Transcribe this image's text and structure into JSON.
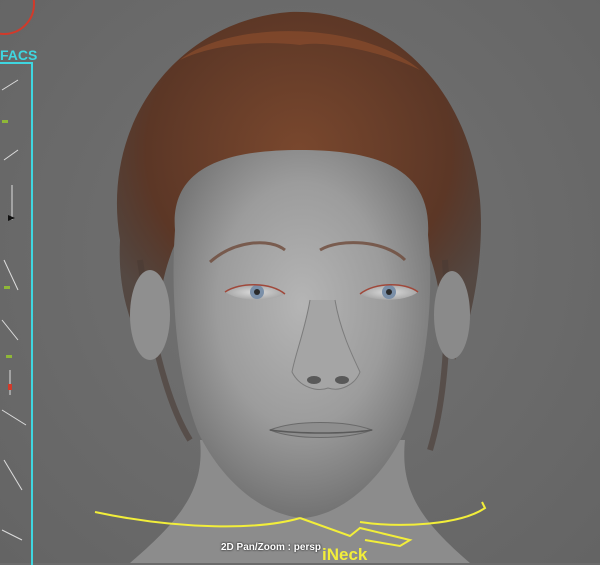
{
  "viewport": {
    "status_text": "2D Pan/Zoom : persp",
    "camera": "persp"
  },
  "facs_panel": {
    "title": "FACS",
    "accent_color": "#3fd6e0"
  },
  "neck_control": {
    "label": "iNeck",
    "color": "#f2ee3a"
  },
  "colors": {
    "viewport_bg": "#6b6b6b",
    "skin": "#9a9a9a",
    "hair": "#6b3a22",
    "control_curve": "#f2ee3a",
    "panel_accent": "#3fd6e0",
    "corner_widget": "#d23a2a"
  }
}
